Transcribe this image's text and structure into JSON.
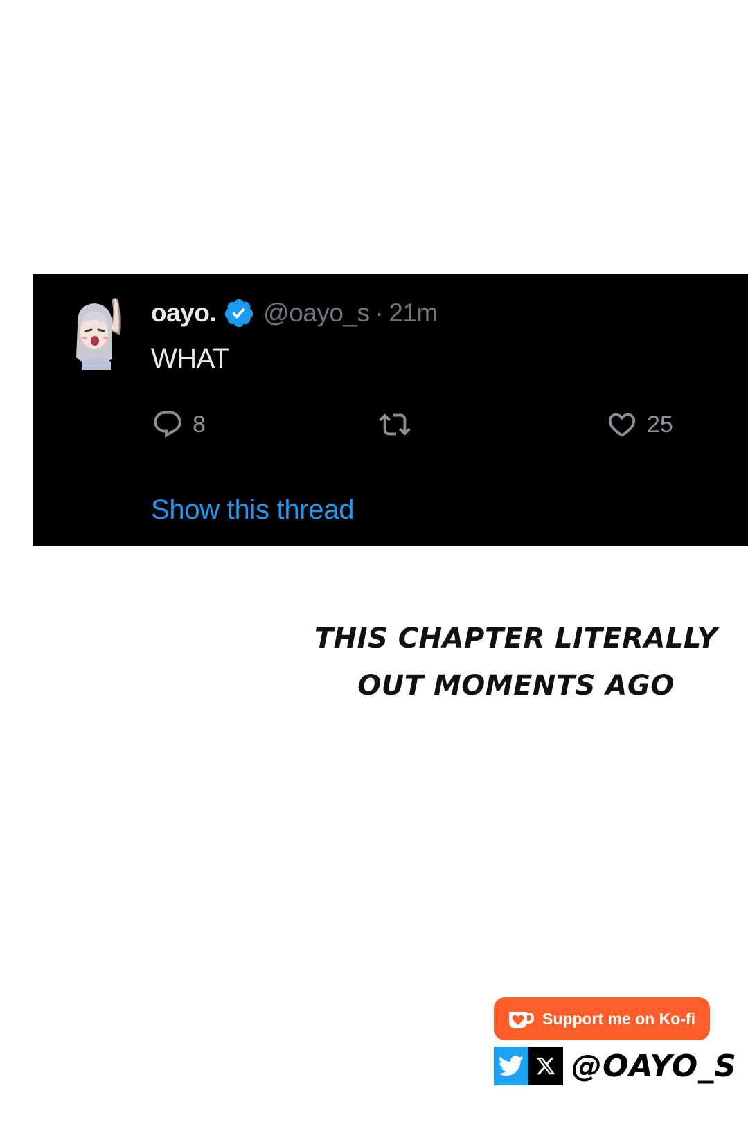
{
  "tweet": {
    "display_name": "oayo.",
    "handle": "@oayo_s",
    "separator": "·",
    "time": "21m",
    "text": "WHAT",
    "actions": {
      "reply_icon": "reply-icon",
      "reply_count": "8",
      "retweet_icon": "retweet-icon",
      "like_icon": "heart-icon",
      "like_count": "25"
    },
    "thread_link": "Show this thread",
    "colors": {
      "background": "#000000",
      "name": "#e7e9ea",
      "muted": "#71767b",
      "link": "#1d9bf0",
      "verified": "#1d9bf0"
    }
  },
  "caption": {
    "line1": "THIS CHAPTER LITERALLY",
    "line2": "OUT MOMENTS AGO"
  },
  "kofi": {
    "label": "Support me on Ko-fi",
    "icon": "kofi-cup-icon",
    "color": "#ff5e2b"
  },
  "social": {
    "twitter_icon": "twitter-bird-icon",
    "x_icon": "x-logo-icon",
    "handle": "@OAYO_S"
  }
}
